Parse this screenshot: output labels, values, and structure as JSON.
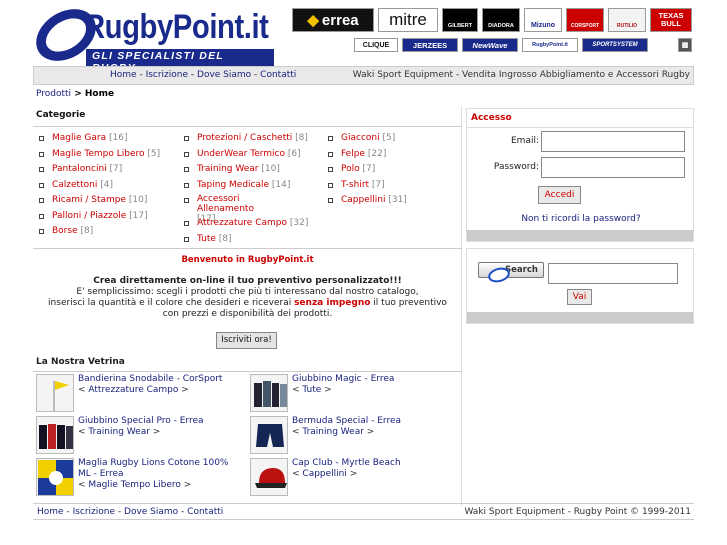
{
  "header": {
    "logo_name": "RugbyPoint.it",
    "logo_tagline": "GLI SPECIALISTI DEL RUGBY",
    "brands_row1": [
      "errea",
      "mitre",
      "GILBERT",
      "DIADORA",
      "Mizuno",
      "CORSPORT",
      "RUTILIO",
      "TEXAS BULL"
    ],
    "brands_row2": [
      "CLIQUE",
      "JERZEES",
      "NewWave",
      "RugbyPoint.it",
      "SPORTSYSTEM",
      "▦"
    ]
  },
  "nav": {
    "links": [
      "Home",
      "Iscrizione",
      "Dove Siamo",
      "Contatti"
    ],
    "separator": " - ",
    "slogan": "Waki Sport Equipment - Vendita Ingrosso Abbigliamento e Accessori Rugby"
  },
  "breadcrumb": {
    "root": "Prodotti",
    "sep": " > ",
    "current": "Home"
  },
  "categories": {
    "title": "Categorie",
    "col1": [
      {
        "label": "Maglie Gara",
        "count": "[16]"
      },
      {
        "label": "Maglie Tempo Libero",
        "count": "[5]"
      },
      {
        "label": "Pantaloncini",
        "count": "[7]"
      },
      {
        "label": "Calzettoni",
        "count": "[4]"
      },
      {
        "label": "Ricami / Stampe",
        "count": "[10]"
      },
      {
        "label": "Palloni / Piazzole",
        "count": "[17]"
      },
      {
        "label": "Borse",
        "count": "[8]"
      }
    ],
    "col2": [
      {
        "label": "Protezioni / Caschetti",
        "count": "[8]"
      },
      {
        "label": "UnderWear Termico",
        "count": "[6]"
      },
      {
        "label": "Training Wear",
        "count": "[10]"
      },
      {
        "label": "Taping Medicale",
        "count": "[14]"
      },
      {
        "label": "Accessori Allenamento",
        "count": "[17]"
      },
      {
        "label": "Attrezzature Campo",
        "count": "[32]"
      },
      {
        "label": "Tute",
        "count": "[8]"
      }
    ],
    "col3": [
      {
        "label": "Giacconi",
        "count": "[5]"
      },
      {
        "label": "Felpe",
        "count": "[22]"
      },
      {
        "label": "Polo",
        "count": "[7]"
      },
      {
        "label": "T-shirt",
        "count": "[7]"
      },
      {
        "label": "Cappellini",
        "count": "[31]"
      }
    ]
  },
  "welcome": {
    "title": "Benvenuto in RugbyPoint.it",
    "line1": "Crea direttamente on-line il tuo preventivo personalizzato!!!",
    "line2": "E' semplicissimo: scegli i prodotti che più ti interessano dal nostro catalogo,",
    "line3a": "inserisci la quantità e il colore che desideri e riceverai ",
    "line3b": "senza impegno",
    "line3c": " il tuo preventivo",
    "line4": "con prezzi e disponibilità dei prodotti.",
    "signup": "Iscriviti ora!"
  },
  "vetrina": {
    "title": "La Nostra Vetrina",
    "lt": "< ",
    "gt": " >",
    "products": [
      {
        "name": "Bandierina Snodabile - CorSport",
        "category": "Attrezzature Campo"
      },
      {
        "name": "Giubbino Magic - Errea",
        "category": "Tute"
      },
      {
        "name": "Giubbino Special Pro - Errea",
        "category": "Training Wear"
      },
      {
        "name": "Bermuda Special - Errea",
        "category": "Training Wear"
      },
      {
        "name": "Maglia Rugby Lions Cotone 100% ML - Errea",
        "category": "Maglie Tempo Libero"
      },
      {
        "name": "Cap Club - Myrtle Beach",
        "category": "Cappellini"
      }
    ]
  },
  "login": {
    "title": "Accesso",
    "email_label": "Email:",
    "password_label": "Password:",
    "submit": "Accedi",
    "forgot": "Non ti ricordi la password?"
  },
  "search": {
    "button": "Search",
    "submit": "Vai"
  },
  "footer": {
    "links": [
      "Home",
      "Iscrizione",
      "Dove Siamo",
      "Contatti"
    ],
    "copyright": "Waki Sport Equipment - Rugby Point © 1999-2011"
  },
  "colors": {
    "brand_blue": "#1a2a8c",
    "accent_red": "#cc0000",
    "link_blue": "#1a237e"
  }
}
